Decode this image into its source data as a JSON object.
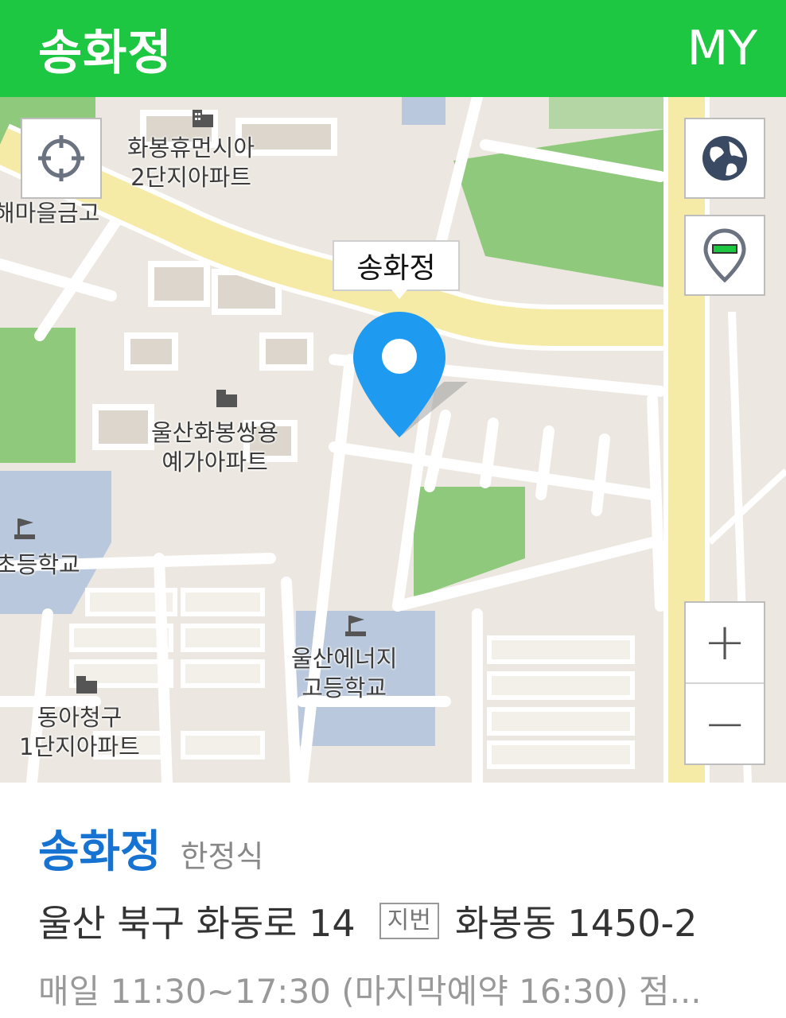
{
  "header": {
    "title": "송화정",
    "my_label": "MY"
  },
  "map": {
    "callout_label": "송화정",
    "labels": {
      "apt1_line1": "화봉휴먼시아",
      "apt1_line2": "2단지아파트",
      "school_left_top": "해마을금고",
      "apt2_line1": "울산화봉쌍용",
      "apt2_line2": "예가아파트",
      "elementary": "초등학교",
      "highschool_line1": "울산에너지",
      "highschool_line2": "고등학교",
      "apt3_line1": "동아청구",
      "apt3_line2": "1단지아파트"
    },
    "controls": {
      "locate_icon": "crosshair-icon",
      "globe_icon": "globe-icon",
      "marker_toggle_icon": "marker-minus-icon",
      "zoom_in": "+",
      "zoom_out": "−"
    },
    "colors": {
      "pin": "#1e9bf0",
      "road_main": "#f5eba6",
      "park": "#8fc97c",
      "school": "#b9c8dc",
      "building": "#d8d3ca"
    }
  },
  "place": {
    "name": "송화정",
    "category": "한정식",
    "road_address": "울산 북구 화동로 14",
    "jibun_badge": "지번",
    "jibun_address": "화봉동 1450-2",
    "hours": "매일 11:30~17:30 (마지막예약 16:30) 점..."
  }
}
